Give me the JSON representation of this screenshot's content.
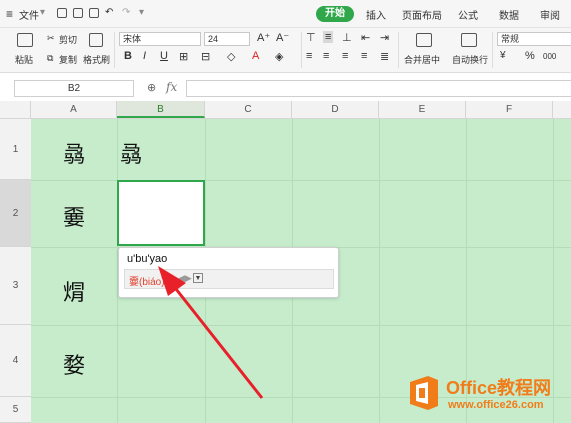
{
  "menubar": {
    "file_label": "文件",
    "tabs": [
      "开始",
      "插入",
      "页面布局",
      "公式",
      "数据",
      "审阅"
    ]
  },
  "ribbon": {
    "paste_label": "粘贴",
    "cut_label": "剪切",
    "copy_label": "复制",
    "format_painter_label": "格式刷",
    "font_name": "宋体",
    "font_size": "24",
    "bold": "B",
    "italic": "I",
    "underline": "U",
    "grow_font": "A⁺",
    "shrink_font": "A⁻",
    "merge_center_label": "合并居中",
    "wrap_text_label": "自动换行",
    "number_format": "常规",
    "percent": "%",
    "thousands": "000"
  },
  "formula_bar": {
    "name_box": "B2",
    "fx_label": "fx",
    "formula": ""
  },
  "columns": [
    "A",
    "B",
    "C",
    "D",
    "E",
    "F"
  ],
  "selected_column": "B",
  "rows": [
    "1",
    "2",
    "3",
    "4",
    "5"
  ],
  "selected_row": "2",
  "cells": {
    "A1": "骉",
    "B1": "骉",
    "A2": "嫑",
    "A3": "焨",
    "A4": "婺"
  },
  "ime": {
    "composition": "u'bu'yao",
    "candidate": "嫑(biáo)"
  },
  "watermark": {
    "title": "Office教程网",
    "url": "www.office26.com"
  },
  "colors": {
    "accent": "#2fa74a",
    "cell_fill": "#c6eccc",
    "annotation_arrow": "#e8202a",
    "watermark": "#f07d1a"
  }
}
